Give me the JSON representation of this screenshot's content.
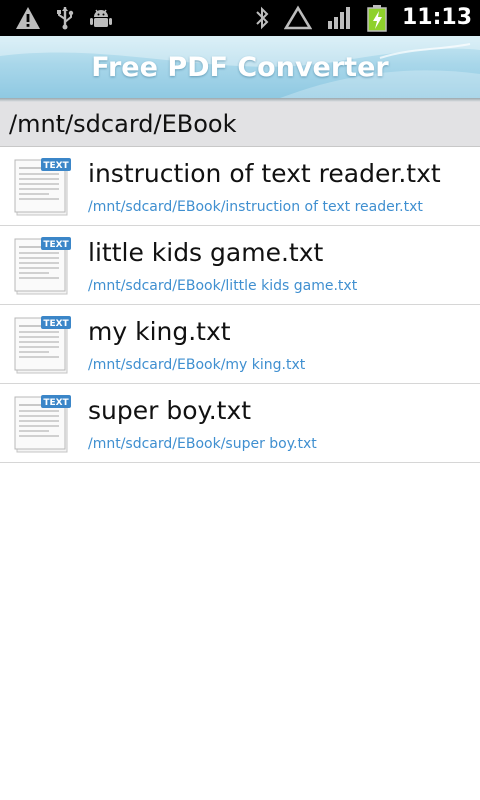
{
  "status_bar": {
    "time": "11:13",
    "left_icons": [
      "warning-icon",
      "usb-icon",
      "android-debug-icon"
    ],
    "right_icons": [
      "bluetooth-icon",
      "no-signal-icon",
      "signal-bars-icon",
      "battery-charging-icon"
    ]
  },
  "app": {
    "title": "Free PDF Converter"
  },
  "current_path": "/mnt/sdcard/EBook",
  "files": [
    {
      "name": "instruction of text reader.txt",
      "path": "/mnt/sdcard/EBook/instruction of text reader.txt",
      "icon": "text-file-icon",
      "icon_badge": "TEXT"
    },
    {
      "name": "little kids game.txt",
      "path": "/mnt/sdcard/EBook/little kids game.txt",
      "icon": "text-file-icon",
      "icon_badge": "TEXT"
    },
    {
      "name": "my king.txt",
      "path": "/mnt/sdcard/EBook/my king.txt",
      "icon": "text-file-icon",
      "icon_badge": "TEXT"
    },
    {
      "name": "super boy.txt",
      "path": "/mnt/sdcard/EBook/super boy.txt",
      "icon": "text-file-icon",
      "icon_badge": "TEXT"
    }
  ],
  "colors": {
    "title_bar": "#a9d7ea",
    "path_header": "#e2e2e4",
    "file_path_text": "#3f8fd0",
    "battery_green": "#8ed12b"
  }
}
